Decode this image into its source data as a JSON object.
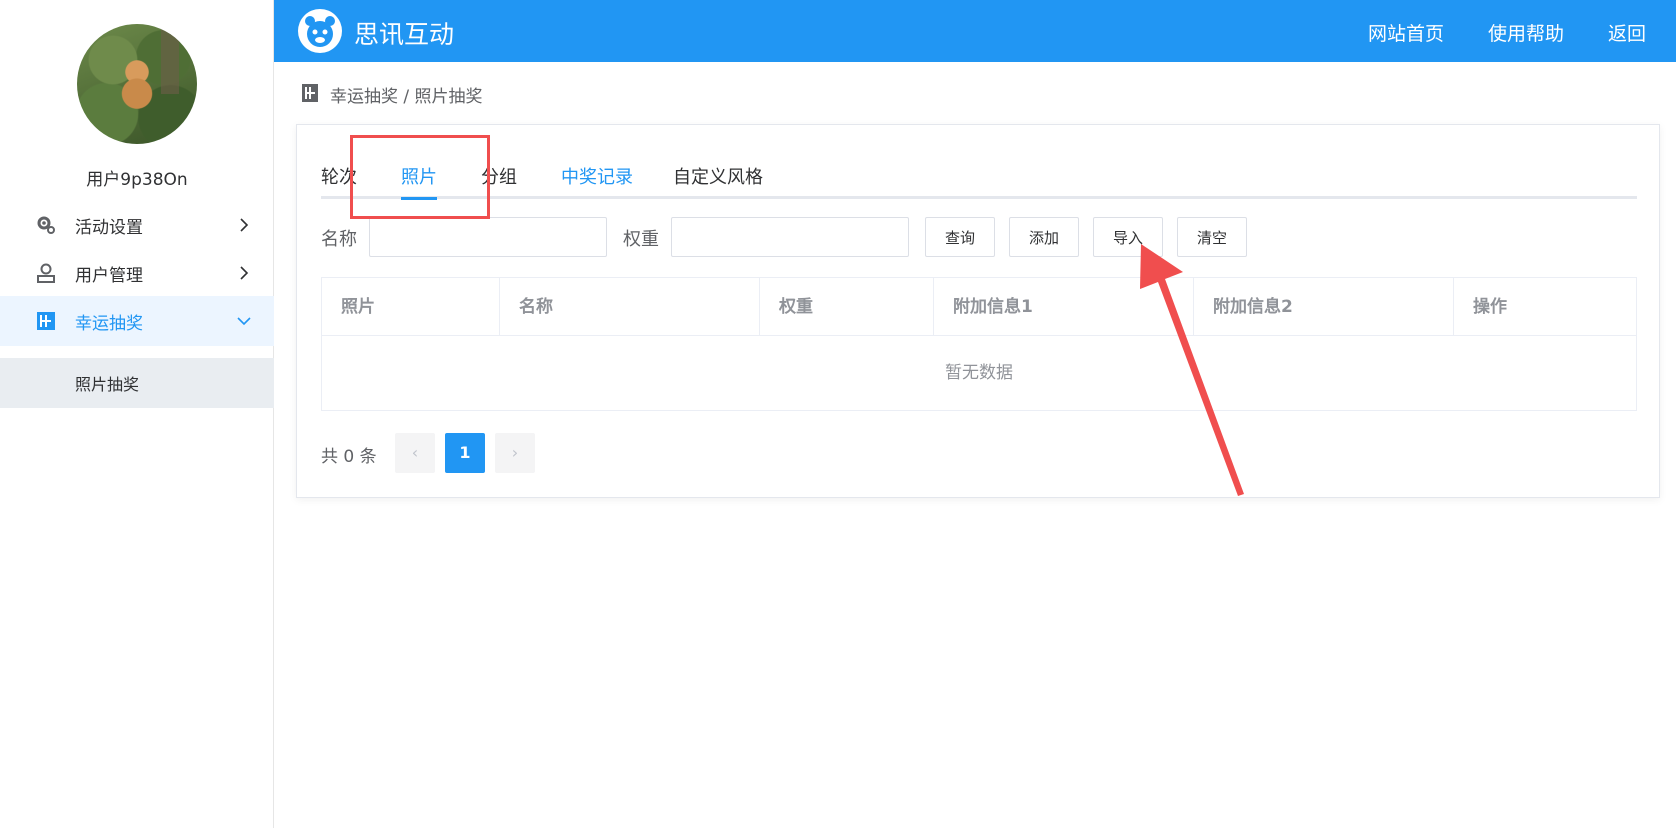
{
  "sidebar": {
    "username": "用户9p38On",
    "menu": [
      {
        "label": "活动设置",
        "icon": "gears-icon",
        "state": "collapsed"
      },
      {
        "label": "用户管理",
        "icon": "user-manage-icon",
        "state": "collapsed"
      },
      {
        "label": "幸运抽奖",
        "icon": "lottery-icon",
        "state": "expanded"
      }
    ],
    "submenu": {
      "label": "照片抽奖"
    }
  },
  "topbar": {
    "brand": "思讯互动",
    "links": [
      "网站首页",
      "使用帮助",
      "返回"
    ]
  },
  "breadcrumb": {
    "text": "幸运抽奖 / 照片抽奖"
  },
  "tabs": [
    {
      "label": "轮次"
    },
    {
      "label": "照片"
    },
    {
      "label": "分组"
    },
    {
      "label": "中奖记录"
    },
    {
      "label": "自定义风格"
    }
  ],
  "active_tab": "照片",
  "filters": {
    "name_label": "名称",
    "name_value": "",
    "weight_label": "权重",
    "weight_value": ""
  },
  "buttons": {
    "query": "查询",
    "add": "添加",
    "import": "导入",
    "clear": "清空"
  },
  "table": {
    "headers": [
      "照片",
      "名称",
      "权重",
      "附加信息1",
      "附加信息2",
      "操作"
    ],
    "rows": [],
    "empty_text": "暂无数据"
  },
  "pagination": {
    "total_text": "共 0 条",
    "current_page": "1",
    "prev": "‹",
    "next": "›"
  },
  "colors": {
    "primary": "#2196f3",
    "annotation": "#f04e4e"
  }
}
